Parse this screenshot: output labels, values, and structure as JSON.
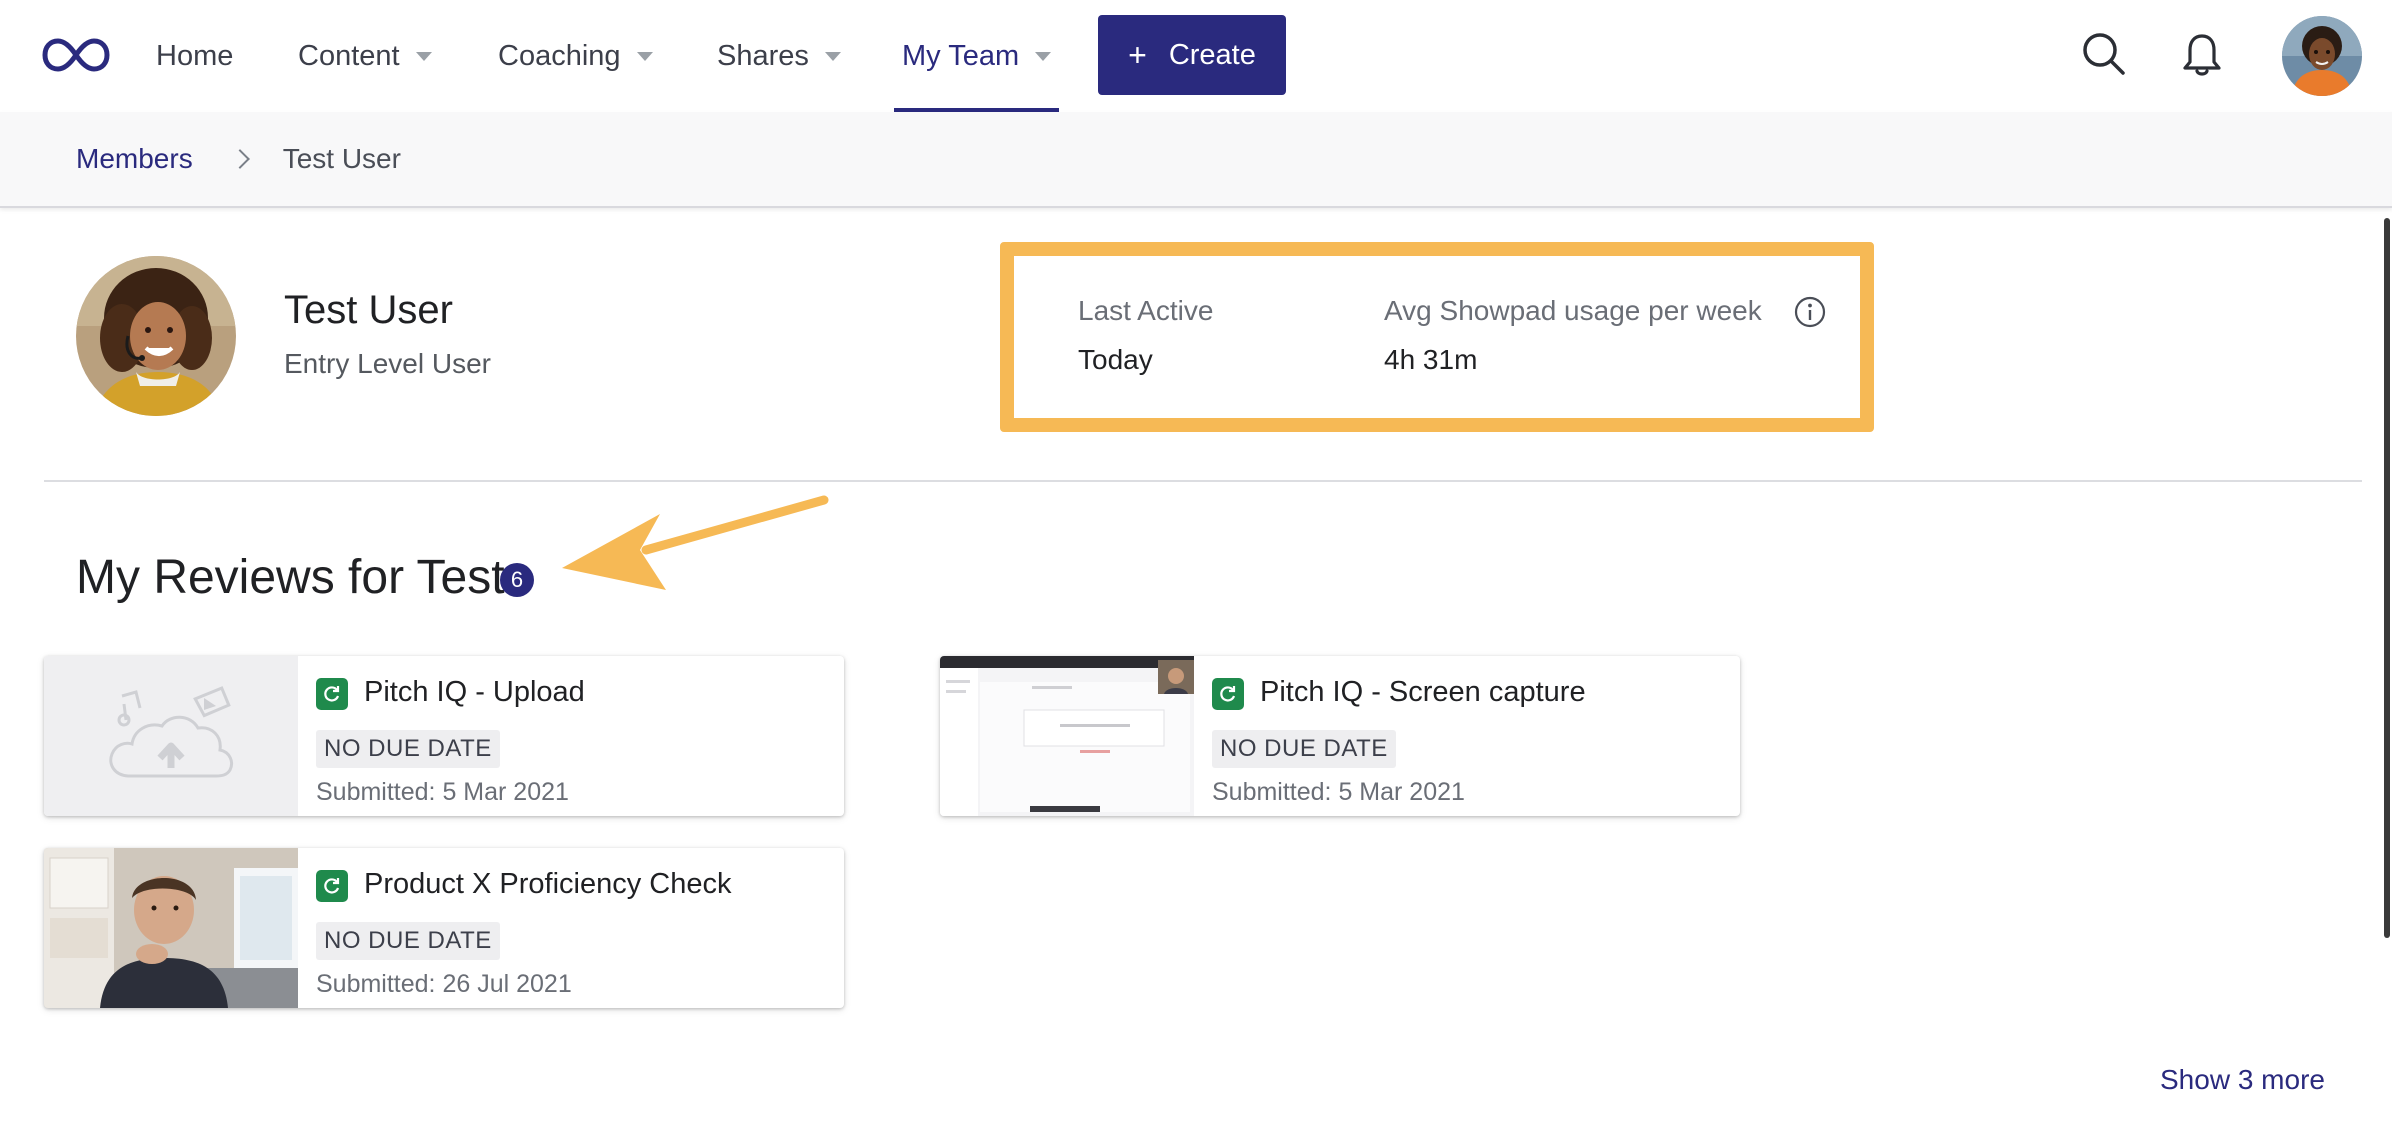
{
  "nav": {
    "items": [
      {
        "label": "Home",
        "has_dropdown": false,
        "active": false
      },
      {
        "label": "Content",
        "has_dropdown": true,
        "active": false
      },
      {
        "label": "Coaching",
        "has_dropdown": true,
        "active": false
      },
      {
        "label": "Shares",
        "has_dropdown": true,
        "active": false
      },
      {
        "label": "My Team",
        "has_dropdown": true,
        "active": true
      }
    ],
    "create_label": "Create",
    "icons": {
      "logo": "infinity-logo-icon",
      "search": "search-icon",
      "notifications": "bell-icon",
      "avatar": "user-avatar"
    }
  },
  "breadcrumb": {
    "parent": "Members",
    "current": "Test User"
  },
  "profile": {
    "name": "Test User",
    "role": "Entry Level User"
  },
  "stats": {
    "last_active_label": "Last Active",
    "last_active_value": "Today",
    "usage_label": "Avg Showpad usage per week",
    "usage_value": "4h 31m",
    "highlight_color": "#f6b955"
  },
  "reviews": {
    "title": "My Reviews for Test",
    "count": "6",
    "cards": [
      {
        "title": "Pitch IQ - Upload",
        "due": "NO DUE DATE",
        "submitted": "Submitted: 5 Mar 2021",
        "thumbnail": "upload-placeholder"
      },
      {
        "title": "Pitch IQ - Screen capture",
        "due": "NO DUE DATE",
        "submitted": "Submitted: 5 Mar 2021",
        "thumbnail": "screen-capture"
      },
      {
        "title": "Product X Proficiency Check",
        "due": "NO DUE DATE",
        "submitted": "Submitted: 26 Jul 2021",
        "thumbnail": "webcam-video"
      }
    ],
    "show_more": "Show 3 more"
  },
  "colors": {
    "brand": "#2a2a7e",
    "status_green": "#1f8a4c",
    "annotation": "#f6b955"
  }
}
